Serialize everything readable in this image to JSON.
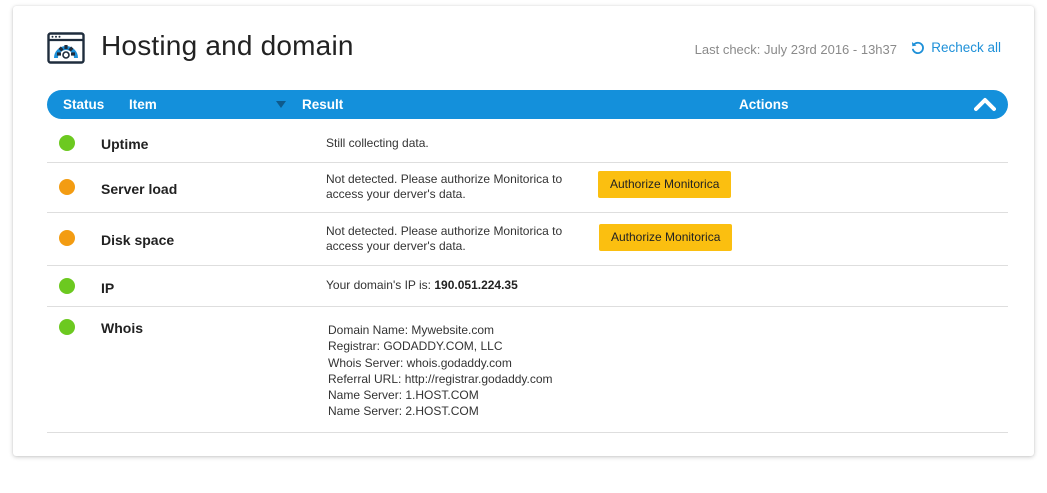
{
  "header": {
    "icon": "settings-window-icon",
    "title": "Hosting and domain",
    "last_check": "Last check: July 23rd 2016 - 13h37",
    "recheck_label": "Recheck all",
    "recheck_icon": "refresh-icon"
  },
  "table": {
    "columns": {
      "status": "Status",
      "item": "Item",
      "result": "Result",
      "actions": "Actions"
    },
    "sort_icon": "caret-down-icon",
    "collapse_icon": "chevron-up-icon"
  },
  "rows": [
    {
      "status": "green",
      "item": "Uptime",
      "result": "Still collecting data."
    },
    {
      "status": "orange",
      "item": "Server load",
      "result": "Not detected. Please authorize Monitorica to access your derver's data.",
      "action": "Authorize Monitorica"
    },
    {
      "status": "orange",
      "item": "Disk space",
      "result": "Not detected. Please authorize Monitorica to access your derver's data.",
      "action": "Authorize Monitorica"
    },
    {
      "status": "green",
      "item": "IP",
      "result_prefix": "Your domain's IP is: ",
      "result_value": "190.051.224.35"
    },
    {
      "status": "green",
      "item": "Whois",
      "whois": [
        "Domain Name: Mywebsite.com",
        "Registrar: GODADDY.COM, LLC",
        "Whois Server: whois.godaddy.com",
        "Referral URL: http://registrar.godaddy.com",
        "Name Server: 1.HOST.COM",
        "Name Server: 2.HOST.COM"
      ]
    }
  ],
  "colors": {
    "accent": "#1490db",
    "ok": "#6cc920",
    "warning": "#f39c12",
    "button": "#fbbf10"
  }
}
